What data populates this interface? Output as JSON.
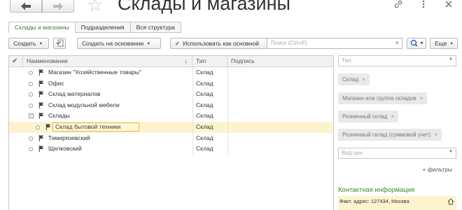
{
  "window": {
    "title": "Склады и магазины",
    "icons": [
      "link-icon",
      "more-vertical-icon",
      "close-icon"
    ]
  },
  "tabs": [
    {
      "label": "Склады и магазины",
      "active": true
    },
    {
      "label": "Подразделения",
      "active": false
    },
    {
      "label": "Вся структура",
      "active": false
    }
  ],
  "toolbar": {
    "create_label": "Создать",
    "create_based_label": "Создать на основании",
    "use_as_main_label": "Использовать как основной",
    "search_placeholder": "Поиск (Ctrl+F)",
    "more_label": "Еще"
  },
  "table": {
    "columns": [
      "Наименование",
      "Тип",
      "Подпись"
    ],
    "rows": [
      {
        "name": "Магазин \"Хозяйственные товары\"",
        "type": "Склад",
        "level": 0,
        "group": false,
        "selected": false
      },
      {
        "name": "Офис",
        "type": "Склад",
        "level": 0,
        "group": false,
        "selected": false
      },
      {
        "name": "Склад материалов",
        "type": "Склад",
        "level": 0,
        "group": false,
        "selected": false
      },
      {
        "name": "Склад модульной мебели",
        "type": "Склад",
        "level": 0,
        "group": false,
        "selected": false
      },
      {
        "name": "Склады",
        "type": "Склад",
        "level": 0,
        "group": true,
        "selected": false
      },
      {
        "name": "Склад бытовой техники",
        "type": "Склад",
        "level": 1,
        "group": false,
        "selected": true
      },
      {
        "name": "Тимирязевский",
        "type": "Склад",
        "level": 0,
        "group": false,
        "selected": false
      },
      {
        "name": "Щелковский",
        "type": "Склад",
        "level": 0,
        "group": false,
        "selected": false
      }
    ]
  },
  "filters": {
    "type_placeholder": "Тип",
    "type_chips": [
      "Склад",
      "Магазин или группа складов",
      "Розничный склад",
      "Розничный склад (суммовой учет)"
    ],
    "price_type_placeholder": "Вид цен",
    "more_filters_label": "+ фильтры"
  },
  "contact": {
    "title": "Контактная информация",
    "address": "Факт. адрес: 127434, Москва"
  },
  "colors": {
    "accent_green": "#3a8a2a",
    "selection_yellow": "#fdf3cf",
    "flag_dark": "#444444",
    "search_blue": "#2a6cc0"
  }
}
